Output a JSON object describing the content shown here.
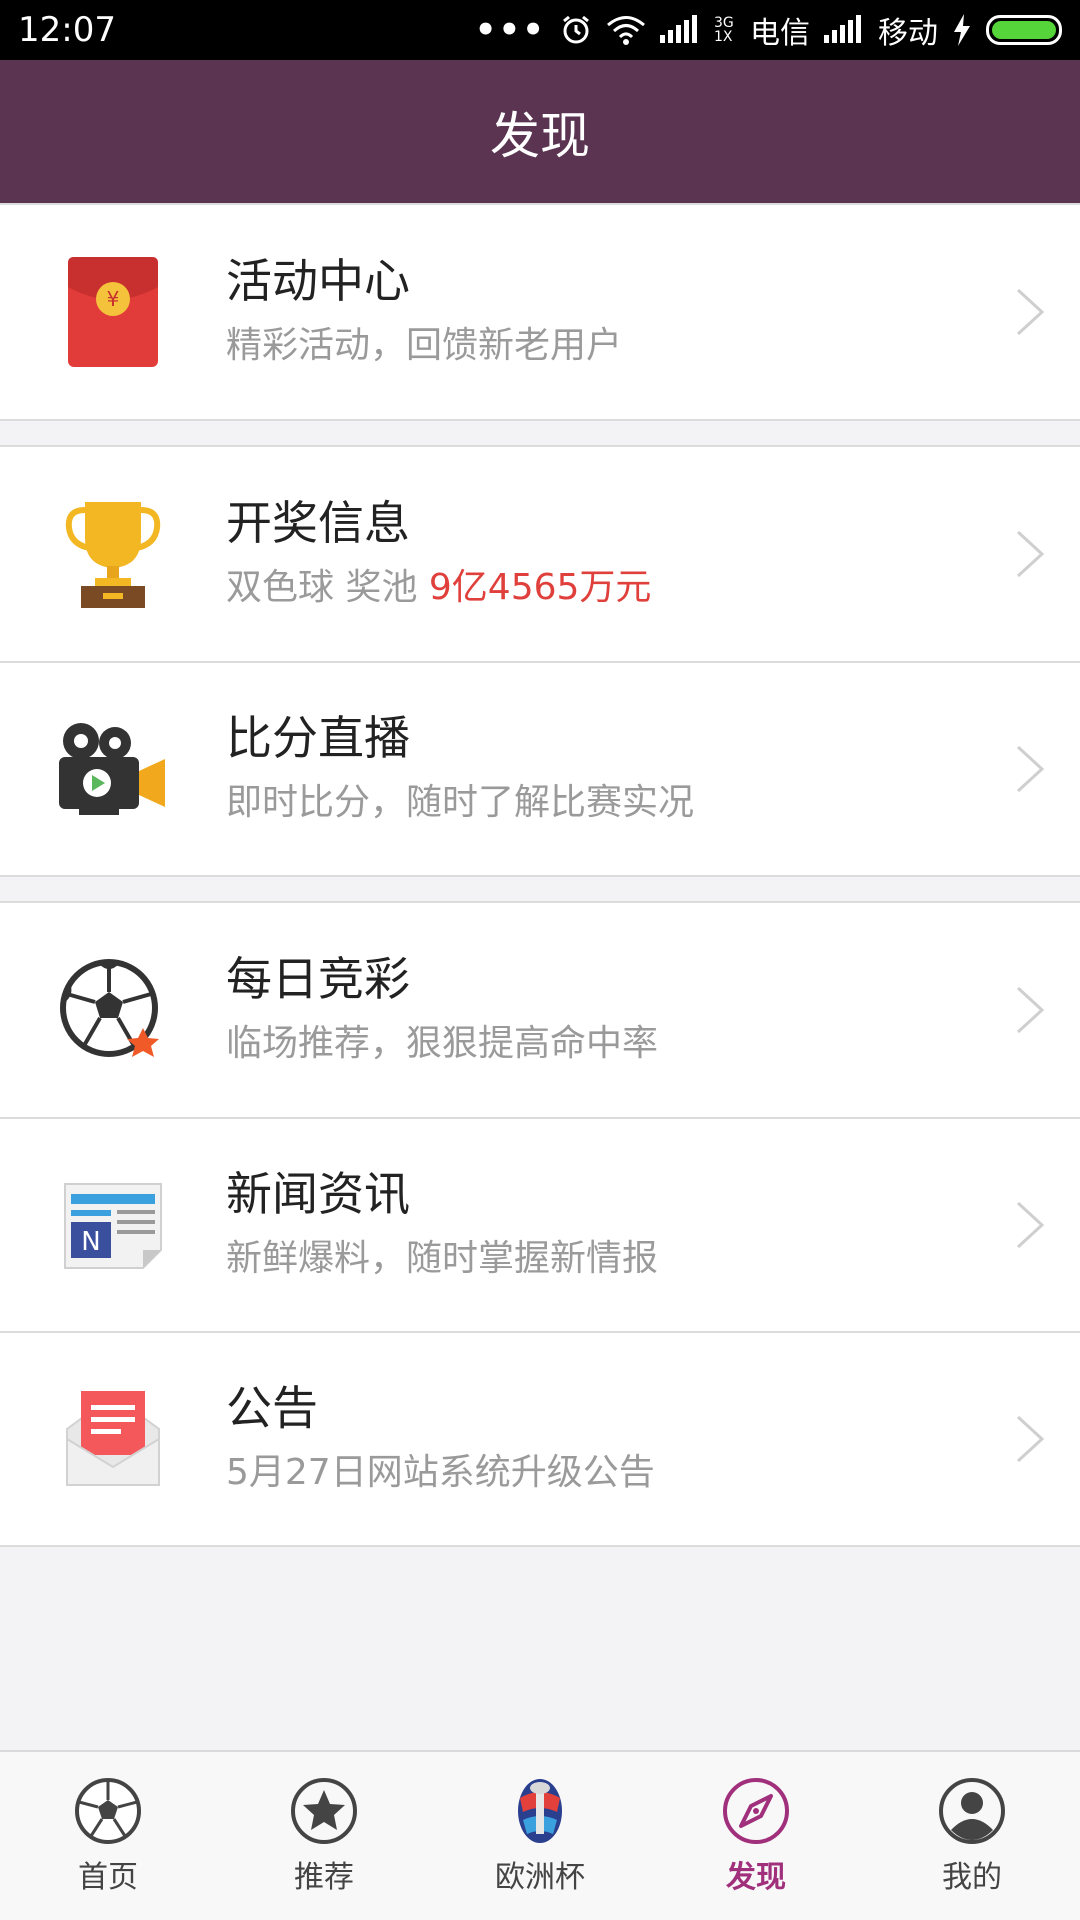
{
  "status_bar": {
    "time": "12:07",
    "network_label": "3G\n1X",
    "carrier_1": "电信",
    "carrier_2": "移动"
  },
  "header": {
    "title": "发现"
  },
  "groups": [
    {
      "items": [
        {
          "title": "活动中心",
          "subtitle": "精彩活动，回馈新老用户",
          "icon": "red-envelope-icon"
        }
      ]
    },
    {
      "items": [
        {
          "title": "开奖信息",
          "subtitle": "双色球 奖池 ",
          "subtitle_highlight": "9亿4565万元",
          "icon": "trophy-icon"
        },
        {
          "title": "比分直播",
          "subtitle": "即时比分，随时了解比赛实况",
          "icon": "video-camera-icon"
        }
      ]
    },
    {
      "items": [
        {
          "title": "每日竞彩",
          "subtitle": "临场推荐，狠狠提高命中率",
          "icon": "soccer-ball-star-icon"
        },
        {
          "title": "新闻资讯",
          "subtitle": "新鲜爆料，随时掌握新情报",
          "icon": "newspaper-icon"
        },
        {
          "title": "公告",
          "subtitle": "5月27日网站系统升级公告",
          "icon": "envelope-icon"
        }
      ]
    }
  ],
  "tabs": [
    {
      "label": "首页",
      "icon": "soccer-ball-icon",
      "active": false
    },
    {
      "label": "推荐",
      "icon": "star-circle-icon",
      "active": false
    },
    {
      "label": "欧洲杯",
      "icon": "euro-cup-icon",
      "active": false
    },
    {
      "label": "发现",
      "icon": "compass-icon",
      "active": true
    },
    {
      "label": "我的",
      "icon": "user-icon",
      "active": false
    }
  ],
  "colors": {
    "header_bg": "#5a3450",
    "highlight_red": "#e0403b",
    "tab_active": "#a0307c"
  }
}
